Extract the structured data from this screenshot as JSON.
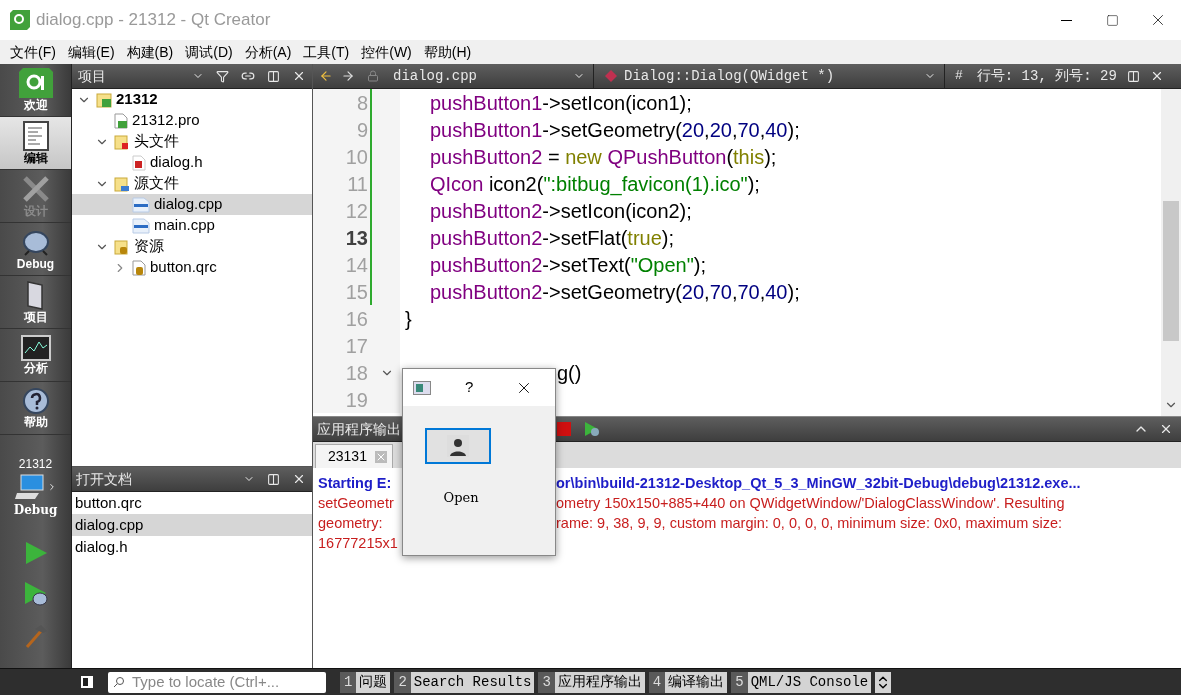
{
  "window": {
    "title": "dialog.cpp - 21312 - Qt Creator"
  },
  "menu": [
    "文件(F)",
    "编辑(E)",
    "构建(B)",
    "调试(D)",
    "分析(A)",
    "工具(T)",
    "控件(W)",
    "帮助(H)"
  ],
  "modes": [
    {
      "label": "欢迎",
      "kind": "welcome",
      "selected": false,
      "disabled": false
    },
    {
      "label": "编辑",
      "kind": "edit",
      "selected": true,
      "disabled": false
    },
    {
      "label": "设计",
      "kind": "design",
      "selected": false,
      "disabled": true
    },
    {
      "label": "Debug",
      "kind": "debug",
      "selected": false,
      "disabled": false
    },
    {
      "label": "项目",
      "kind": "projects",
      "selected": false,
      "disabled": false
    },
    {
      "label": "分析",
      "kind": "analyze",
      "selected": false,
      "disabled": false
    },
    {
      "label": "帮助",
      "kind": "help",
      "selected": false,
      "disabled": false
    }
  ],
  "kit": {
    "project": "21312",
    "config": "Debug"
  },
  "projects_panel": {
    "title": "项目",
    "tree": [
      {
        "label": "21312",
        "kind": "project",
        "selected": false,
        "expanded": true,
        "children": [
          {
            "label": "21312.pro",
            "kind": "pro",
            "selected": false
          },
          {
            "label": "头文件",
            "kind": "folder-h",
            "selected": false,
            "expanded": true,
            "children": [
              {
                "label": "dialog.h",
                "kind": "h",
                "selected": false
              }
            ]
          },
          {
            "label": "源文件",
            "kind": "folder-cpp",
            "selected": false,
            "expanded": true,
            "children": [
              {
                "label": "dialog.cpp",
                "kind": "cpp",
                "selected": true
              },
              {
                "label": "main.cpp",
                "kind": "cpp",
                "selected": false
              }
            ]
          },
          {
            "label": "资源",
            "kind": "folder-res",
            "selected": false,
            "expanded": true,
            "children": [
              {
                "label": "button.qrc",
                "kind": "qrc",
                "selected": false,
                "expanded": false
              }
            ]
          }
        ]
      }
    ]
  },
  "open_documents": {
    "title": "打开文档",
    "items": [
      {
        "label": "button.qrc",
        "selected": false
      },
      {
        "label": "dialog.cpp",
        "selected": true
      },
      {
        "label": "dialog.h",
        "selected": false
      }
    ]
  },
  "editor": {
    "file": "dialog.cpp",
    "symbol": "Dialog::Dialog(QWidget *)",
    "hash": "#",
    "position": "行号: 13, 列号: 29",
    "lines": [
      {
        "number": "8",
        "indented": true,
        "changed": true,
        "current": false,
        "tokens": [
          {
            "text": "pushButton1",
            "kind": "member"
          },
          {
            "text": "->setIcon(icon1);",
            "kind": "plain"
          }
        ]
      },
      {
        "number": "9",
        "indented": true,
        "changed": true,
        "current": false,
        "tokens": [
          {
            "text": "pushButton1",
            "kind": "member"
          },
          {
            "text": "->setGeometry(",
            "kind": "plain"
          },
          {
            "text": "20",
            "kind": "number"
          },
          {
            "text": ",",
            "kind": "plain"
          },
          {
            "text": "20",
            "kind": "number"
          },
          {
            "text": ",",
            "kind": "plain"
          },
          {
            "text": "70",
            "kind": "number"
          },
          {
            "text": ",",
            "kind": "plain"
          },
          {
            "text": "40",
            "kind": "number"
          },
          {
            "text": ");",
            "kind": "plain"
          }
        ]
      },
      {
        "number": "10",
        "indented": true,
        "changed": true,
        "current": false,
        "tokens": [
          {
            "text": "pushButton2",
            "kind": "member"
          },
          {
            "text": " = ",
            "kind": "plain"
          },
          {
            "text": "new",
            "kind": "keyword"
          },
          {
            "text": "QPushButton",
            "kind": "member",
            "space_before": true
          },
          {
            "text": "(",
            "kind": "plain"
          },
          {
            "text": "this",
            "kind": "keyword"
          },
          {
            "text": ");",
            "kind": "plain"
          }
        ]
      },
      {
        "number": "11",
        "indented": true,
        "changed": true,
        "current": false,
        "tokens": [
          {
            "text": "QIcon",
            "kind": "member"
          },
          {
            "text": " icon2(",
            "kind": "plain"
          },
          {
            "text": "\":bitbug_favicon(1).ico\"",
            "kind": "string"
          },
          {
            "text": ");",
            "kind": "plain"
          }
        ]
      },
      {
        "number": "12",
        "indented": true,
        "changed": true,
        "current": false,
        "tokens": [
          {
            "text": "pushButton2",
            "kind": "member"
          },
          {
            "text": "->setIcon(icon2);",
            "kind": "plain"
          }
        ]
      },
      {
        "number": "13",
        "indented": true,
        "changed": true,
        "current": true,
        "tokens": [
          {
            "text": "pushButton2",
            "kind": "member"
          },
          {
            "text": "->setFlat(",
            "kind": "plain"
          },
          {
            "text": "true",
            "kind": "keyword"
          },
          {
            "text": ");",
            "kind": "plain"
          }
        ]
      },
      {
        "number": "14",
        "indented": true,
        "changed": true,
        "current": false,
        "tokens": [
          {
            "text": "pushButton2",
            "kind": "member"
          },
          {
            "text": "->setText(",
            "kind": "plain"
          },
          {
            "text": "\"Open\"",
            "kind": "string"
          },
          {
            "text": ");",
            "kind": "plain"
          }
        ]
      },
      {
        "number": "15",
        "indented": true,
        "changed": true,
        "current": false,
        "tokens": [
          {
            "text": "pushButton2",
            "kind": "member"
          },
          {
            "text": "->setGeometry(",
            "kind": "plain"
          },
          {
            "text": "20",
            "kind": "number"
          },
          {
            "text": ",",
            "kind": "plain"
          },
          {
            "text": "70",
            "kind": "number"
          },
          {
            "text": ",",
            "kind": "plain"
          },
          {
            "text": "70",
            "kind": "number"
          },
          {
            "text": ",",
            "kind": "plain"
          },
          {
            "text": "40",
            "kind": "number"
          },
          {
            "text": ");",
            "kind": "plain"
          }
        ]
      },
      {
        "number": "16",
        "kind": "brace",
        "changed": false,
        "current": false,
        "tokens": [
          {
            "text": "}",
            "kind": "plain"
          }
        ]
      },
      {
        "number": "17",
        "kind": "blank",
        "changed": false,
        "current": false
      },
      {
        "number": "18",
        "kind": "signature",
        "changed": false,
        "current": false,
        "tokens": [
          {
            "text": "g()",
            "kind": "plain"
          }
        ]
      },
      {
        "number": "19",
        "kind": "blank",
        "changed": false,
        "current": false
      }
    ]
  },
  "output": {
    "title": "应用程序输出",
    "tabs": [
      {
        "label": "23131",
        "selected": true
      }
    ],
    "lines": [
      {
        "kind": "info",
        "visible_start": "Starting E:",
        "visible_end": "or\\bin\\build-21312-Desktop_Qt_5_3_MinGW_32bit-Debug\\debug\\21312.exe..."
      },
      {
        "kind": "error",
        "visible_start": "setGeometr",
        "visible_end": "ometry 150x150+885+440 on QWidgetWindow/'DialogClassWindow'. Resulting"
      },
      {
        "kind": "error",
        "visible_start": "geometry:",
        "visible_end": "rame: 9, 38, 9, 9, custom margin: 0, 0, 0, 0, minimum size: 0x0, maximum size:"
      },
      {
        "kind": "error",
        "visible_start": "16777215x1"
      }
    ]
  },
  "dialog": {
    "help": "?",
    "buttons": [
      {
        "kind": "icon"
      },
      {
        "kind": "flat",
        "label": "Open"
      }
    ]
  },
  "locator": {
    "placeholder": "Type to locate (Ctrl+..."
  },
  "panes": [
    {
      "number": "1",
      "label": "问题"
    },
    {
      "number": "2",
      "label": "Search Results"
    },
    {
      "number": "3",
      "label": "应用程序输出"
    },
    {
      "number": "4",
      "label": "编译输出"
    },
    {
      "number": "5",
      "label": "QML/JS Console"
    }
  ]
}
